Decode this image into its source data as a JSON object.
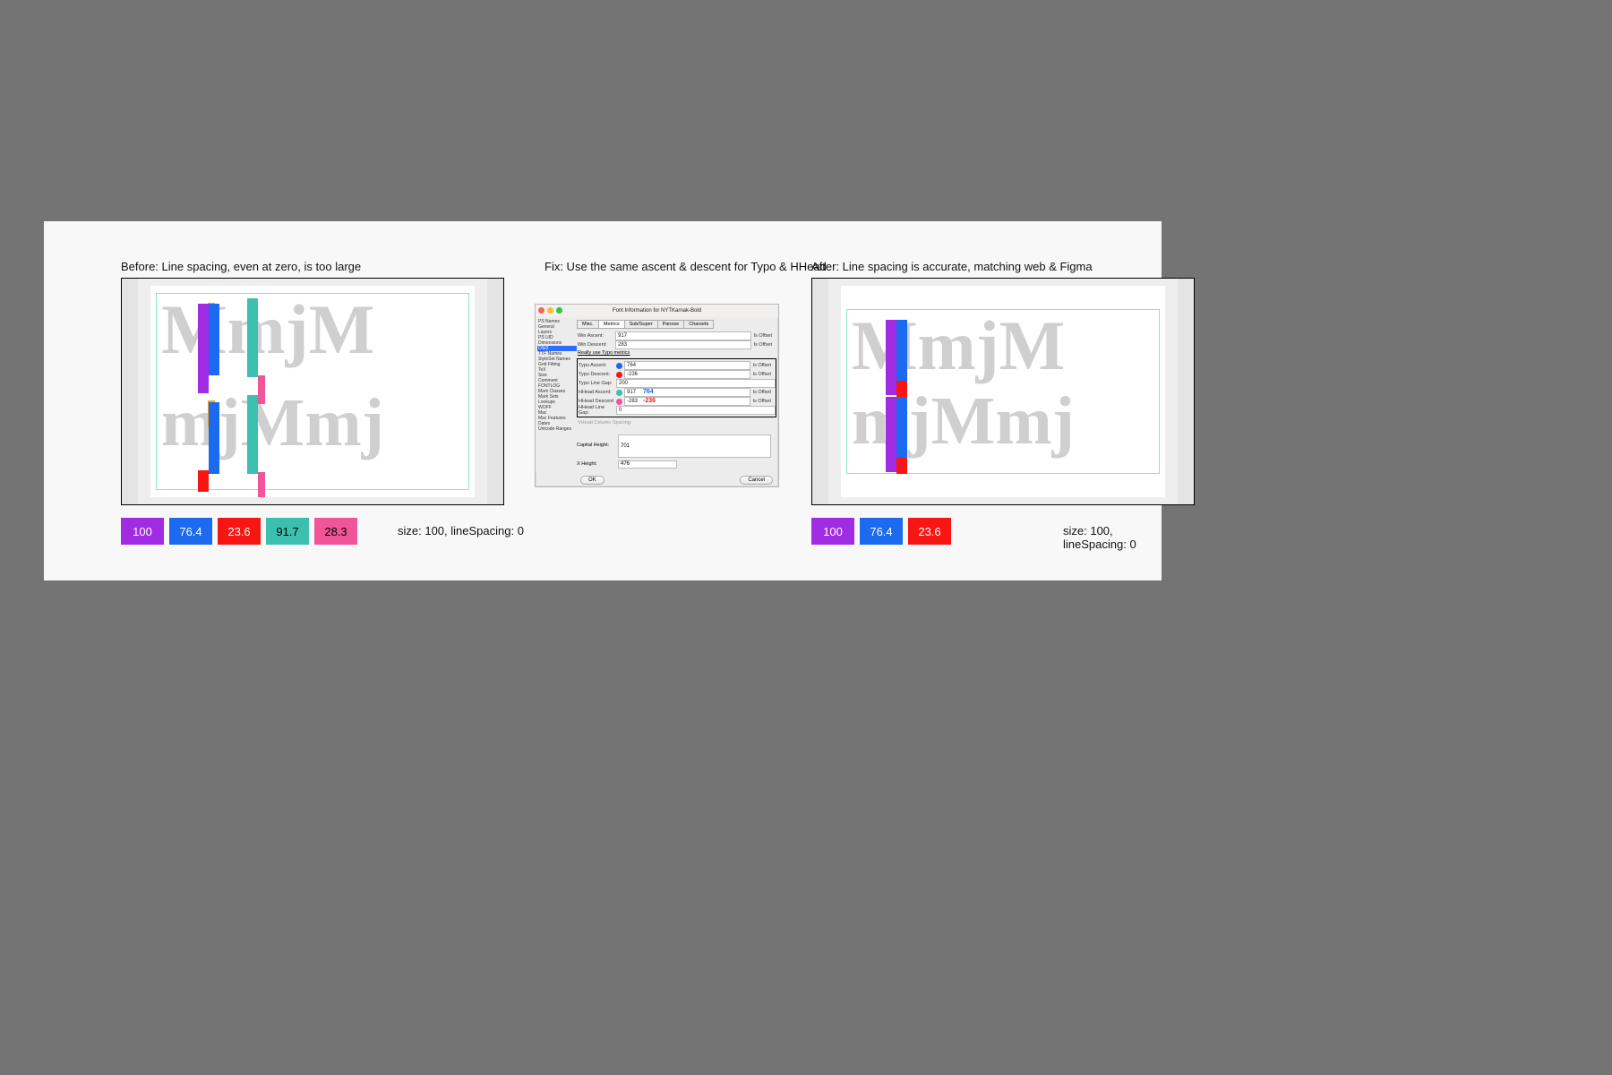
{
  "panels": {
    "before": {
      "title": "Before: Line spacing, even at zero, is too large",
      "caption": "size: 100, lineSpacing: 0",
      "sample_line1": "MmjM",
      "sample_line2": "mjMmj",
      "chips": [
        {
          "label": "100",
          "bg": "c-purple",
          "dark": true
        },
        {
          "label": "76.4",
          "bg": "c-blue",
          "dark": true
        },
        {
          "label": "23.6",
          "bg": "c-red",
          "dark": true
        },
        {
          "label": "91.7",
          "bg": "c-teal"
        },
        {
          "label": "28.3",
          "bg": "c-pink"
        }
      ]
    },
    "fix": {
      "title": "Fix: Use the same ascent & descent for Typo & HHead"
    },
    "after": {
      "title": "After: Line spacing is accurate, matching web & Figma",
      "caption": "size: 100, lineSpacing: 0",
      "sample_line1": "MmjM",
      "sample_line2": "mjMmj",
      "chips": [
        {
          "label": "100",
          "bg": "c-purple",
          "dark": true
        },
        {
          "label": "76.4",
          "bg": "c-blue",
          "dark": true
        },
        {
          "label": "23.6",
          "bg": "c-red",
          "dark": true
        }
      ]
    }
  },
  "dialog": {
    "title": "Font Information for NYTKarnak-Bold",
    "traffic": {
      "close": "#ff5f57",
      "min": "#febc2e",
      "max": "#28c840"
    },
    "sidebar": [
      "PS Names",
      "General",
      "Layers",
      "PS UID",
      "Dimensions",
      "OS/2",
      "TTF Names",
      "StyleSet Names",
      "Grid Fitting",
      "TeX",
      "Size",
      "Comment",
      "FONTLOG",
      "Mark Classes",
      "Mark Sets",
      "Lookups",
      "WOFF",
      "Mac",
      "Mac Features",
      "Dates",
      "Unicode Ranges"
    ],
    "sidebar_selected": "OS/2",
    "tabs": [
      "Misc.",
      "Metrics",
      "Sub/Super",
      "Panose",
      "Charsets"
    ],
    "tab_selected": "Metrics",
    "rows": {
      "win_ascent": {
        "label": "Win Ascent:",
        "value": "917",
        "offset": "Is Offset"
      },
      "win_descent": {
        "label": "Win Descent:",
        "value": "283",
        "offset": "Is Offset"
      },
      "really_checkbox": "Really use Typo metrics",
      "typo_ascent": {
        "label": "Typo Ascent:",
        "value": "764",
        "offset": "Is Offset",
        "dot": "c-blue"
      },
      "typo_descent": {
        "label": "Typo Descent:",
        "value": "-236",
        "offset": "Is Offset",
        "dot": "c-red"
      },
      "typo_linegap": {
        "label": "Typo Line Gap:",
        "value": "200"
      },
      "hhead_ascent": {
        "label": "HHead Ascent:",
        "value": "917",
        "offset": "Is Offset",
        "dot": "c-teal",
        "annot": "764",
        "annot_color": "#1b6af0"
      },
      "hhead_descent": {
        "label": "HHead Descent:",
        "value": "-283",
        "offset": "Is Offset",
        "dot": "c-pink",
        "annot": "-236",
        "annot_color": "#f71614"
      },
      "hhead_linegap": {
        "label": "HHead Line Gap:",
        "value": "0"
      },
      "vhead_gap": {
        "label": "VHead Column Spacing:",
        "value": ""
      }
    },
    "capital_height": {
      "label": "Capital Height:",
      "value": "701"
    },
    "x_height": {
      "label": "X Height:",
      "value": "476"
    },
    "ok": "OK",
    "cancel": "Cancel"
  }
}
